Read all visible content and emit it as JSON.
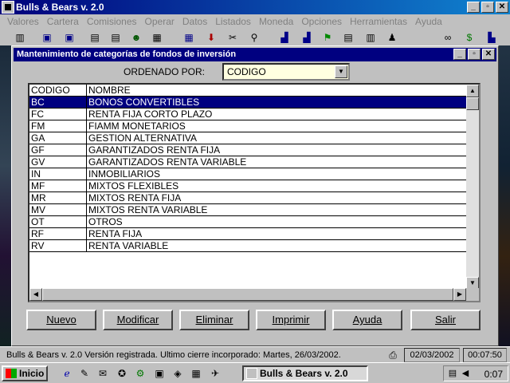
{
  "app": {
    "title": "Bulls & Bears v. 2.0",
    "window_buttons": [
      "_",
      "▫",
      "✕"
    ]
  },
  "menubar": {
    "items": [
      "Valores",
      "Cartera",
      "Comisiones",
      "Operar",
      "Datos",
      "Listados",
      "Moneda",
      "Opciones",
      "Herramientas",
      "Ayuda"
    ]
  },
  "toolbar": {
    "icons": [
      "book-icon",
      "window-icon",
      "window-icon",
      "document-icon",
      "document-icon",
      "people-icon",
      "calculator-icon",
      "download-icon",
      "tools-icon",
      "search-icon",
      "chart-icon",
      "flag-icon",
      "dollar-icon",
      "chart-icon"
    ]
  },
  "dialog": {
    "title": "Mantenimiento de categorías de fondos de inversión",
    "window_buttons": [
      "_",
      "▫",
      "✕"
    ],
    "sort_label": "ORDENADO POR:",
    "sort_value": "CODIGO",
    "columns": [
      "CODIGO",
      "NOMBRE"
    ],
    "rows": [
      {
        "code": "BC",
        "name": "BONOS CONVERTIBLES",
        "selected": true
      },
      {
        "code": "FC",
        "name": "RENTA FIJA CORTO PLAZO"
      },
      {
        "code": "FM",
        "name": "FIAMM MONETARIOS"
      },
      {
        "code": "GA",
        "name": "GESTION ALTERNATIVA"
      },
      {
        "code": "GF",
        "name": "GARANTIZADOS RENTA FIJA"
      },
      {
        "code": "GV",
        "name": "GARANTIZADOS RENTA VARIABLE"
      },
      {
        "code": "IN",
        "name": "INMOBILIARIOS"
      },
      {
        "code": "MF",
        "name": "MIXTOS FLEXIBLES"
      },
      {
        "code": "MR",
        "name": "MIXTOS RENTA FIJA"
      },
      {
        "code": "MV",
        "name": "MIXTOS RENTA VARIABLE"
      },
      {
        "code": "OT",
        "name": "OTROS"
      },
      {
        "code": "RF",
        "name": "RENTA FIJA"
      },
      {
        "code": "RV",
        "name": "RENTA VARIABLE"
      }
    ],
    "buttons": [
      "Nuevo",
      "Modificar",
      "Eliminar",
      "Imprimir",
      "Ayuda",
      "Salir"
    ]
  },
  "statusbar": {
    "text": "Bulls & Bears v. 2.0  Versión registrada.   Ultimo cierre incorporado: Martes, 26/03/2002.",
    "date": "02/03/2002",
    "time": "00:07:50"
  },
  "taskbar": {
    "start_label": "Inicio",
    "task_label": "Bulls & Bears v. 2.0",
    "clock": "0:07",
    "quicklaunch_icons": [
      "ie-icon",
      "outlook-icon",
      "app-icon",
      "app-icon",
      "app-icon",
      "app-icon",
      "app-icon",
      "app-icon",
      "app-icon"
    ],
    "tray_icons": [
      "network-icon",
      "speaker-icon"
    ]
  }
}
